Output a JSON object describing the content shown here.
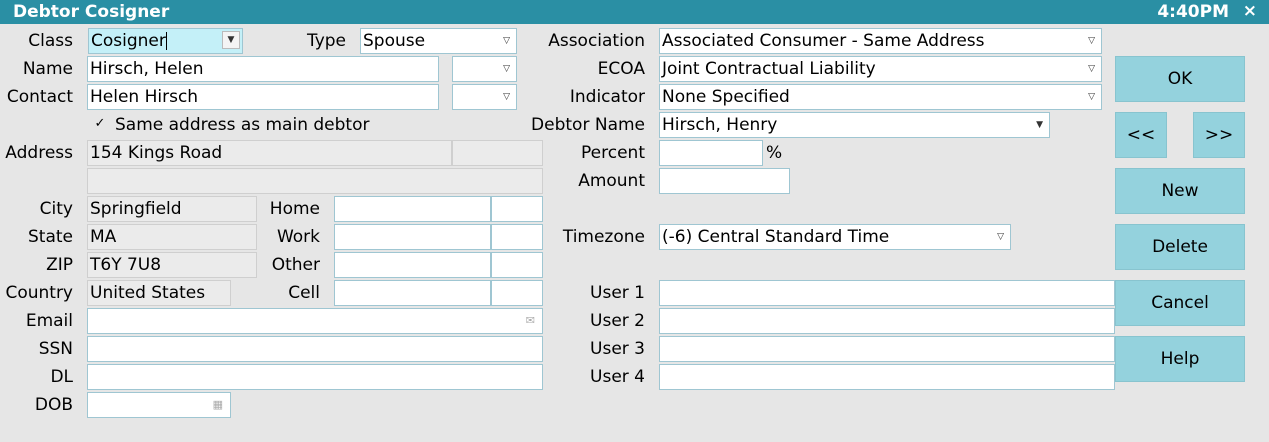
{
  "window": {
    "title": "Debtor Cosigner",
    "time": "4:40PM",
    "close": "×"
  },
  "labels": {
    "class": "Class",
    "type": "Type",
    "association": "Association",
    "name": "Name",
    "ecoa": "ECOA",
    "contact": "Contact",
    "indicator": "Indicator",
    "same_address": "Same address as main debtor",
    "debtor_name": "Debtor Name",
    "address": "Address",
    "percent": "Percent",
    "percent_sign": "%",
    "amount": "Amount",
    "city": "City",
    "home": "Home",
    "state": "State",
    "work": "Work",
    "timezone": "Timezone",
    "zip": "ZIP",
    "other": "Other",
    "country": "Country",
    "cell": "Cell",
    "email": "Email",
    "ssn": "SSN",
    "dl": "DL",
    "dob": "DOB",
    "user1": "User 1",
    "user2": "User 2",
    "user3": "User 3",
    "user4": "User 4"
  },
  "values": {
    "class": "Cosigner",
    "type": "Spouse",
    "association": "Associated Consumer - Same Address",
    "name": "Hirsch, Helen",
    "ecoa": "Joint Contractual Liability",
    "contact": "Helen Hirsch",
    "indicator": "None Specified",
    "debtor_name": "Hirsch, Henry",
    "address1": "154 Kings Road",
    "city": "Springfield",
    "state": "MA",
    "zip": "T6Y 7U8",
    "country": "United States",
    "timezone": "(-6) Central Standard Time",
    "same_address_checked": true
  },
  "buttons": {
    "ok": "OK",
    "prev": "<<",
    "next": ">>",
    "new": "New",
    "delete": "Delete",
    "cancel": "Cancel",
    "help": "Help"
  },
  "icons": {
    "dropdown": "chevron-down-icon",
    "email": "envelope-icon",
    "calendar": "calendar-icon",
    "check": "checkmark-icon"
  },
  "colors": {
    "titlebar": "#2a8fa4",
    "button": "#94d2dd",
    "field_border": "#9fc6d2",
    "highlight": "#c4f0f8"
  }
}
